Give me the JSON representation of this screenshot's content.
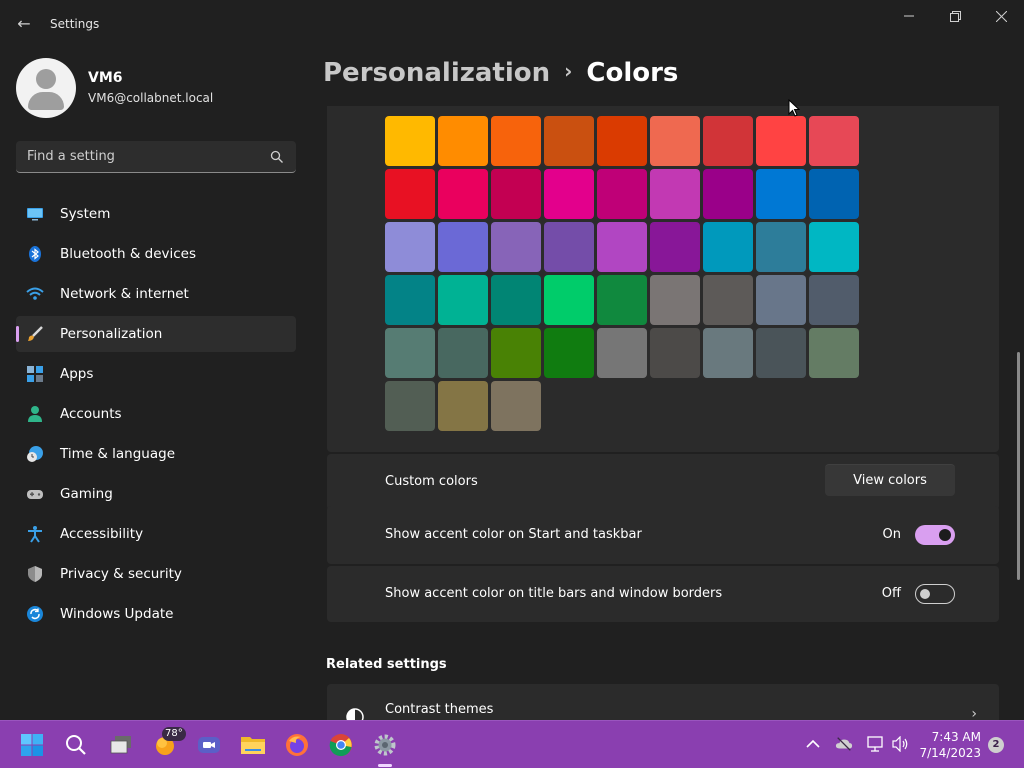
{
  "window": {
    "app_title": "Settings",
    "back_glyph": "←"
  },
  "profile": {
    "name": "VM6",
    "email": "VM6@collabnet.local"
  },
  "search": {
    "placeholder": "Find a setting"
  },
  "nav": {
    "items": [
      {
        "label": "System",
        "icon": "monitor-icon"
      },
      {
        "label": "Bluetooth & devices",
        "icon": "bluetooth-icon"
      },
      {
        "label": "Network & internet",
        "icon": "wifi-icon"
      },
      {
        "label": "Personalization",
        "icon": "brush-icon",
        "active": true
      },
      {
        "label": "Apps",
        "icon": "apps-icon"
      },
      {
        "label": "Accounts",
        "icon": "person-icon"
      },
      {
        "label": "Time & language",
        "icon": "globe-clock-icon"
      },
      {
        "label": "Gaming",
        "icon": "gamepad-icon"
      },
      {
        "label": "Accessibility",
        "icon": "accessibility-icon"
      },
      {
        "label": "Privacy & security",
        "icon": "shield-icon"
      },
      {
        "label": "Windows Update",
        "icon": "update-icon"
      }
    ]
  },
  "breadcrumb": {
    "parent": "Personalization",
    "separator": "›",
    "current": "Colors"
  },
  "accent_colors": [
    [
      "#FFB900",
      "#FF8C00",
      "#F7630C",
      "#CA5010",
      "#DA3B01",
      "#EF6950",
      "#D13438",
      "#FF4343",
      "#E74856"
    ],
    [
      "#E81123",
      "#EA005E",
      "#C30052",
      "#E3008C",
      "#BF0077",
      "#C239B3",
      "#9A0089",
      "#0078D4",
      "#0063B1"
    ],
    [
      "#8E8CD8",
      "#6B69D6",
      "#8764B8",
      "#744DA9",
      "#B146C2",
      "#881798",
      "#0099BC",
      "#2D7D9A",
      "#00B7C3"
    ],
    [
      "#038387",
      "#00B294",
      "#018574",
      "#00CC6A",
      "#10893E",
      "#7A7574",
      "#5D5A58",
      "#68768A",
      "#515C6B"
    ],
    [
      "#567C73",
      "#486860",
      "#498205",
      "#107C10",
      "#767676",
      "#4C4A48",
      "#69797E",
      "#4A5459",
      "#647C64"
    ],
    [
      "#525E54",
      "#847545",
      "#7E735F"
    ]
  ],
  "custom_colors": {
    "label": "Custom colors",
    "button": "View colors"
  },
  "accent_start_taskbar": {
    "label": "Show accent color on Start and taskbar",
    "state": "On"
  },
  "accent_title_bars": {
    "label": "Show accent color on title bars and window borders",
    "state": "Off"
  },
  "related": {
    "title": "Related settings",
    "contrast_themes": "Contrast themes",
    "chevron": "›"
  },
  "taskbar": {
    "weather_temp": "78°",
    "time": "7:43 AM",
    "date": "7/14/2023",
    "notification_count": "2",
    "accent": "#8A3FB0"
  },
  "theme": {
    "accent": "#D99FF0",
    "background": "#202020",
    "card": "#2B2B2B"
  }
}
